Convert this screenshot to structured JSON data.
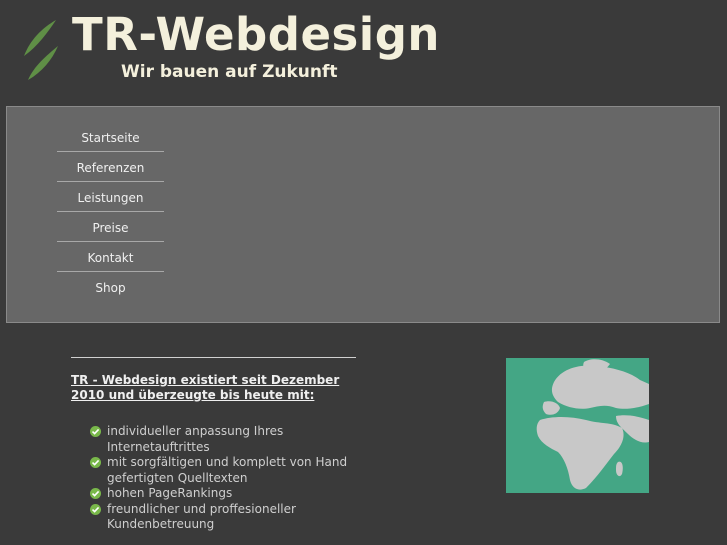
{
  "header": {
    "title": "TR-Webdesign",
    "slogan": "Wir bauen auf Zukunft",
    "logo_icon": "leaf-icon"
  },
  "nav": {
    "items": [
      {
        "label": "Startseite"
      },
      {
        "label": "Referenzen"
      },
      {
        "label": "Leistungen"
      },
      {
        "label": "Preise"
      },
      {
        "label": "Kontakt"
      },
      {
        "label": "Shop"
      }
    ]
  },
  "content": {
    "intro": "TR - Webdesign existiert seit Dezember 2010 und überzeugte bis heute mit:",
    "features": [
      {
        "text": "individueller anpassung Ihres Internetauftrittes",
        "icon": "checkmark-icon"
      },
      {
        "text": "mit sorgfältigen und komplett von Hand gefertigten Quelltexten",
        "icon": "checkmark-icon"
      },
      {
        "text": "hohen PageRankings",
        "icon": "checkmark-icon"
      },
      {
        "text": "freundlicher und proffesioneller Kundenbetreuung",
        "icon": "checkmark-icon"
      }
    ],
    "image_icon": "globe-icon"
  },
  "colors": {
    "background": "#3a3a3a",
    "nav_background": "#676767",
    "title": "#f4f0dc",
    "globe_ocean": "#44a685",
    "globe_land": "#c8c8c8",
    "check": "#79b84a"
  }
}
